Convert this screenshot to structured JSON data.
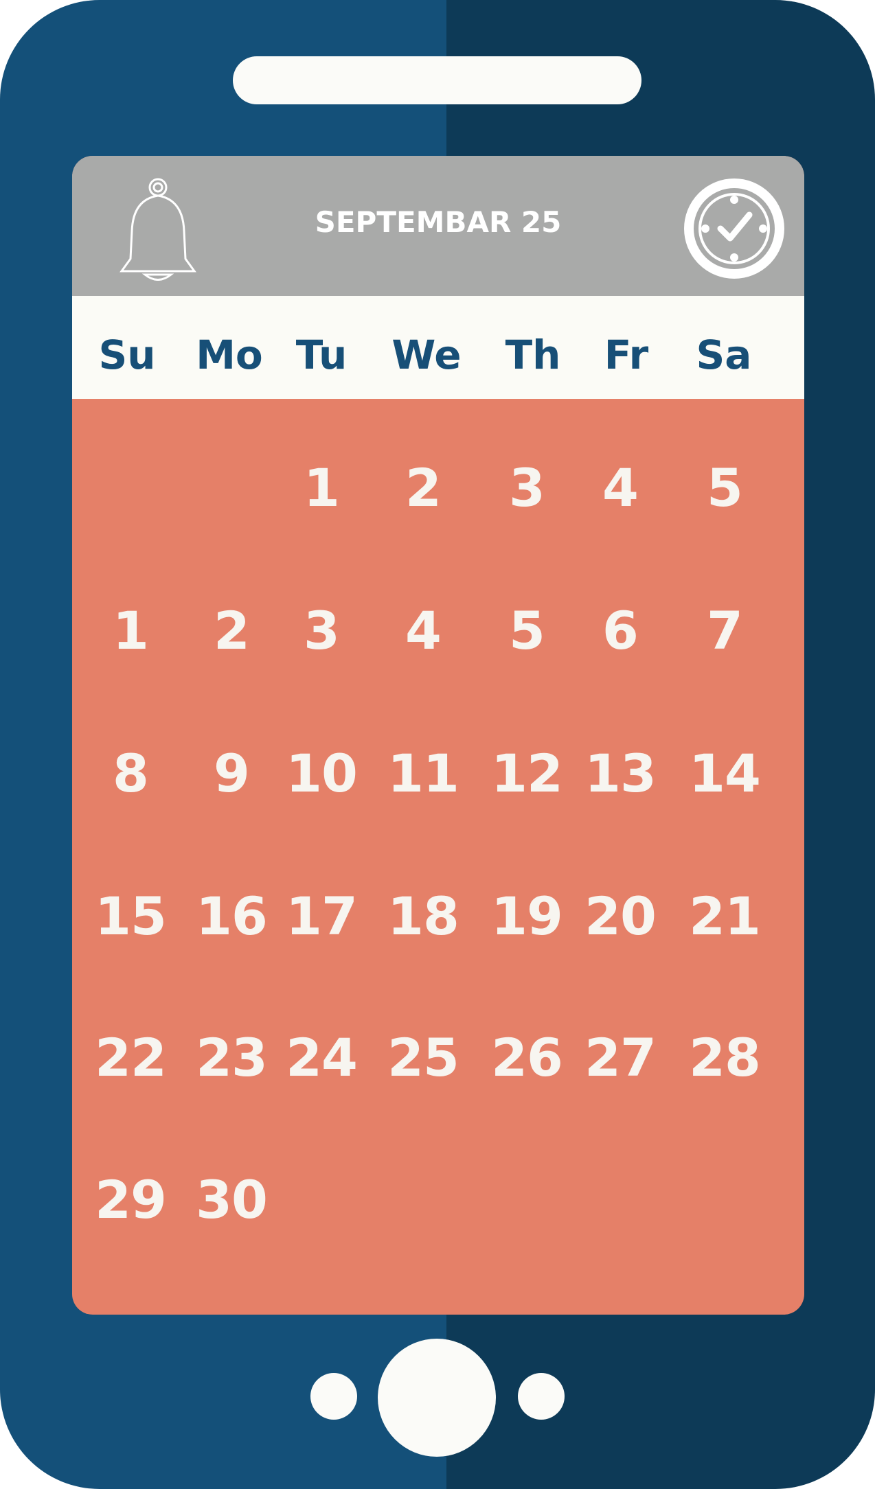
{
  "header": {
    "title": "SEPTEMBAR 25",
    "bell_icon": "bell-icon",
    "clock_icon": "clock-check-icon"
  },
  "weekdays": [
    "Su",
    "Mo",
    "Tu",
    "We",
    "Th",
    "Fr",
    "Sa"
  ],
  "rows": [
    [
      "",
      "",
      "1",
      "2",
      "3",
      "4",
      "5"
    ],
    [
      "1",
      "2",
      "3",
      "4",
      "5",
      "6",
      "7"
    ],
    [
      "8",
      "9",
      "10",
      "11",
      "12",
      "13",
      "14"
    ],
    [
      "15",
      "16",
      "17",
      "18",
      "19",
      "20",
      "21"
    ],
    [
      "22",
      "23",
      "24",
      "25",
      "26",
      "27",
      "28"
    ],
    [
      "29",
      "30",
      "",
      "",
      "",
      "",
      ""
    ]
  ],
  "colors": {
    "phone_left": "#145079",
    "phone_right": "#0d3a57",
    "header_bg": "#a9aaa9",
    "weekday_bg": "#fbfbf6",
    "weekday_text": "#174f77",
    "grid_bg": "#e58068",
    "number_text": "#f7f5f0"
  }
}
